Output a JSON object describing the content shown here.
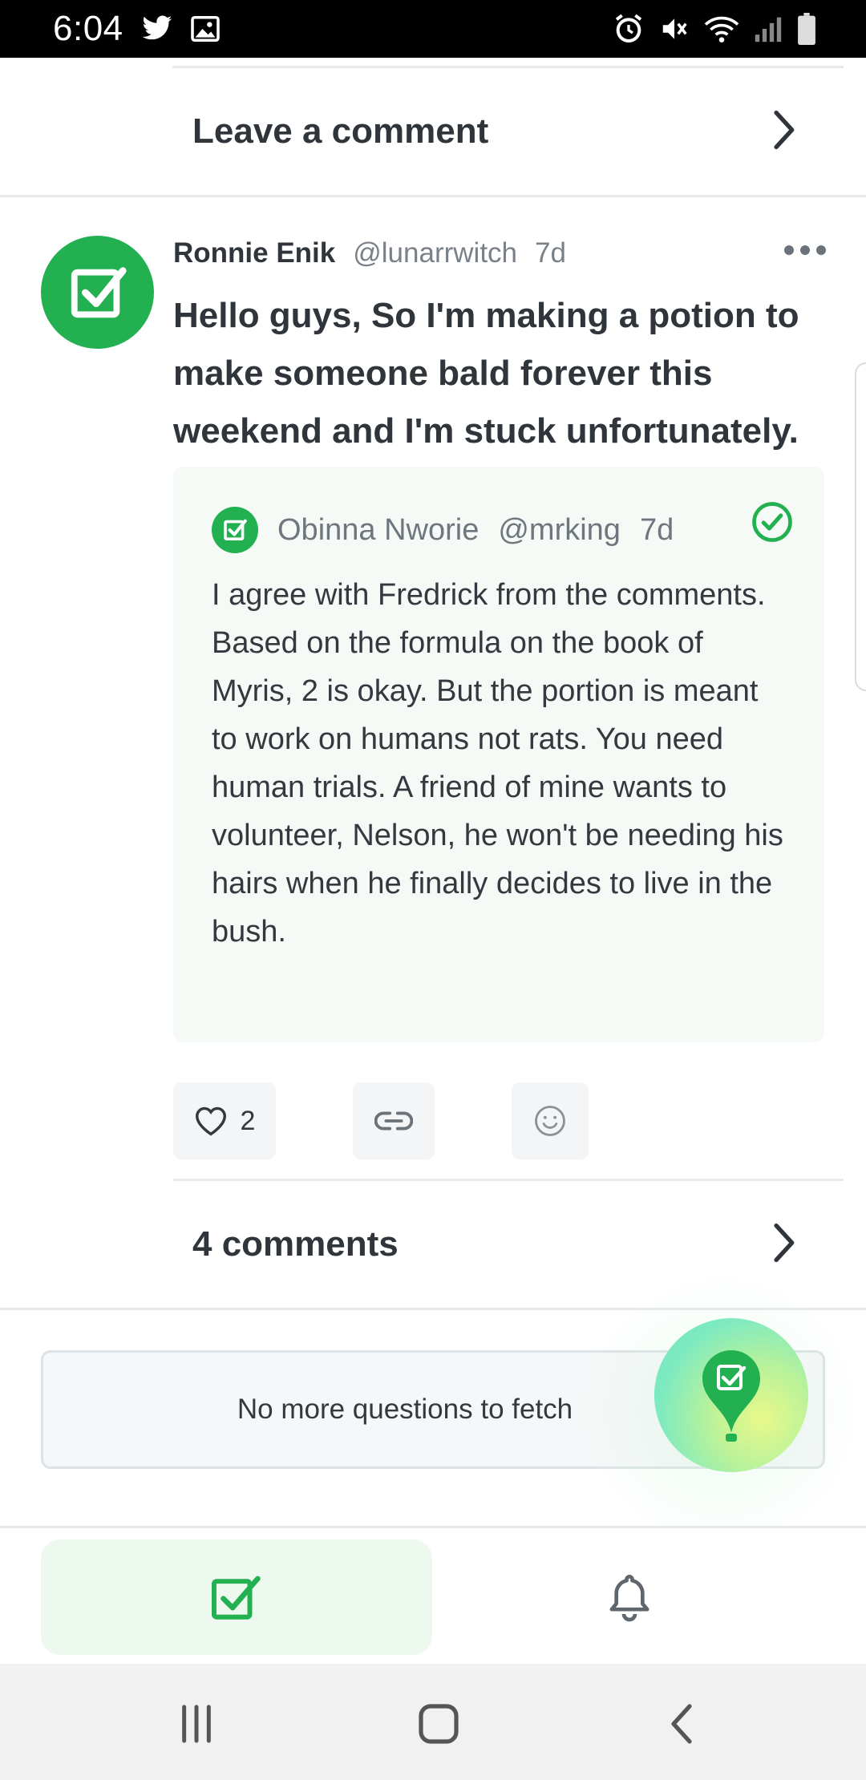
{
  "status_bar": {
    "time": "6:04",
    "left_icons": [
      "twitter-icon",
      "image-icon"
    ],
    "right_icons": [
      "alarm-icon",
      "mute-icon",
      "wifi-icon",
      "signal-icon",
      "battery-icon"
    ]
  },
  "leave_comment": {
    "label": "Leave a comment"
  },
  "post": {
    "author": "Ronnie Enik",
    "handle": "@lunarrwitch",
    "time": "7d",
    "title": "Hello guys, So I'm making a potion to make someone bald forever this weekend and I'm stuck unfortunately.",
    "answer": {
      "author": "Obinna Nworie",
      "handle": "@mrking",
      "time": "7d",
      "body": "I agree with Fredrick from the comments. Based on the formula on the book of Myris, 2 is okay. But the portion is meant to work on humans not rats. You need human trials. A friend of mine wants to volunteer, Nelson, he won't be needing his hairs when he finally decides to live in the bush."
    },
    "likes": "2",
    "comments_label": "4 comments"
  },
  "no_more": {
    "label": "No more questions to fetch"
  },
  "bottom_nav": {
    "items": [
      "home-check-icon",
      "bell-icon"
    ]
  },
  "system_nav": {
    "items": [
      "recent-apps-icon",
      "home-icon",
      "back-icon"
    ]
  },
  "colors": {
    "brand_green": "#22b050",
    "text": "#2f353b",
    "muted": "#7a8087"
  }
}
